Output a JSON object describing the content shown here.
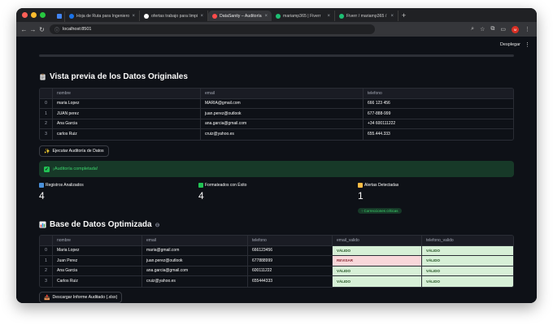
{
  "browser": {
    "tabs": [
      {
        "title": "Hoja de Ruta para Ingeniero de...",
        "favicon_color": "#1a73e8",
        "active": false
      },
      {
        "title": "ofertas trabajo para limpiador d...",
        "favicon_color": "#ffffff",
        "active": false
      },
      {
        "title": "DataSanity – Auditoría de Dat...",
        "favicon_color": "#ff4b4b",
        "active": true
      },
      {
        "title": "mariamp365 | Fiverr",
        "favicon_color": "#1dbf73",
        "active": false
      },
      {
        "title": "Fiverr / mariamp365 / Edit Gi...",
        "favicon_color": "#1dbf73",
        "active": false
      }
    ],
    "url": "localhost:8501",
    "profile_initial": "M",
    "icons": [
      "back-icon",
      "forward-icon",
      "reload-icon",
      "info-icon",
      "zoom-icon",
      "star-icon",
      "extensions-icon",
      "sidebar-icon",
      "menu-icon"
    ]
  },
  "app": {
    "deploy_label": "Desplegar",
    "kebab_label": "⋮"
  },
  "section1": {
    "title": "Vista previa de los Datos Originales",
    "icon": "clipboard-icon",
    "columns": [
      "",
      "nombre",
      "email",
      "telefono"
    ],
    "rows": [
      [
        "0",
        "maria Lopez",
        "MARIA@gmail.com",
        "666 123 456"
      ],
      [
        "1",
        "JUAN perez",
        "juan.perez@outlook",
        "677-888-999"
      ],
      [
        "2",
        "Ana Garcia",
        "ana.garcia@gmail.com",
        "+34 600111222"
      ],
      [
        "3",
        "carlos Ruiz",
        "cruiz@yahoo.es",
        "655.444.333"
      ]
    ]
  },
  "audit_button": {
    "label": "Ejecutar Auditoría de Datos",
    "icon": "sparkle-icon"
  },
  "success": {
    "message": "¡Auditoría completada!"
  },
  "metrics": [
    {
      "label": "Registros Analizados",
      "value": "4",
      "icon": "bar-chart-icon",
      "icon_color": "#4a90d9"
    },
    {
      "label": "Formateados con Éxito",
      "value": "4",
      "icon": "check-icon",
      "icon_color": "#21c354"
    },
    {
      "label": "Alertas Detectadas",
      "value": "1",
      "icon": "warning-icon",
      "icon_color": "#ffbd45",
      "delta": "↑ Correcciones críticas"
    }
  ],
  "section2": {
    "title": "Base de Datos Optimizada",
    "icon": "chart-icon",
    "columns": [
      "",
      "nombre",
      "email",
      "telefono",
      "email_valido",
      "telefono_valido"
    ],
    "rows": [
      [
        "0",
        "Maria Lopez",
        "maria@gmail.com",
        "666123456",
        "VÁLIDO",
        "VÁLIDO"
      ],
      [
        "1",
        "Juan Perez",
        "juan.perez@outlook",
        "677888999",
        "REVISAR",
        "VÁLIDO"
      ],
      [
        "2",
        "Ana Garcia",
        "ana.garcia@gmail.com",
        "600111222",
        "VÁLIDO",
        "VÁLIDO"
      ],
      [
        "3",
        "Carlos Ruiz",
        "cruiz@yahoo.es",
        "655444333",
        "VÁLIDO",
        "VÁLIDO"
      ]
    ]
  },
  "download_button": {
    "label": "Descargar Informe Auditado (.xlsx)",
    "icon": "inbox-tray-icon"
  }
}
